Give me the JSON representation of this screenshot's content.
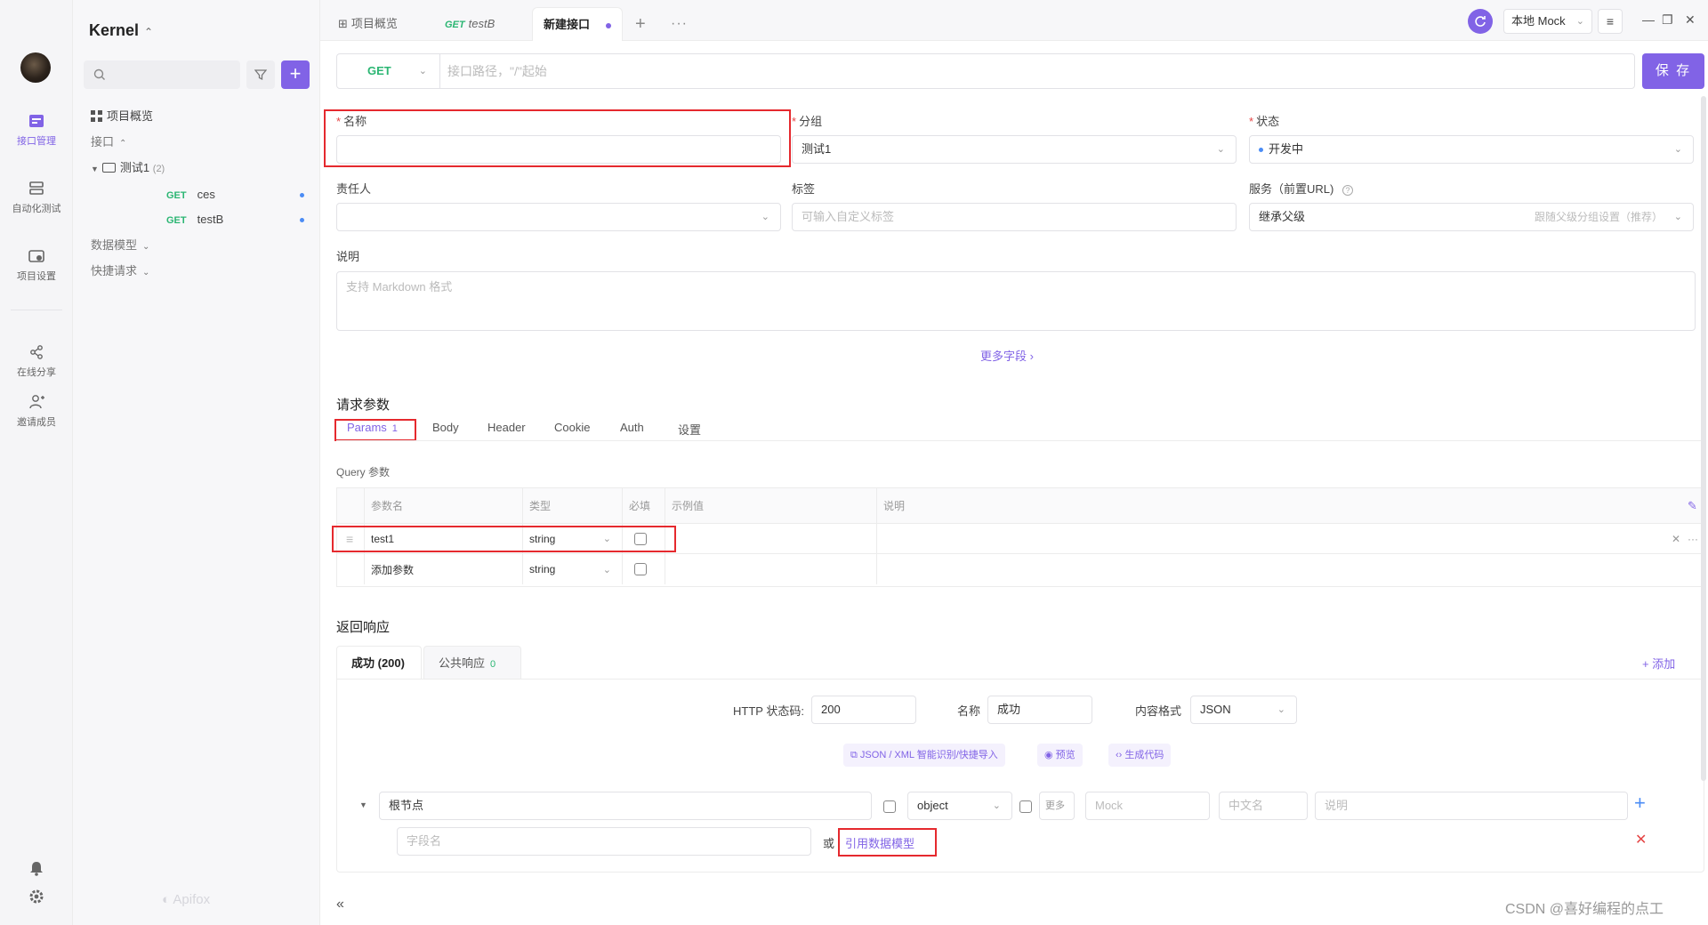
{
  "rail": {
    "items": [
      {
        "label": "接口管理",
        "icon": "api-management-icon",
        "active": true
      },
      {
        "label": "自动化测试",
        "icon": "automation-test-icon",
        "active": false
      },
      {
        "label": "项目设置",
        "icon": "project-settings-icon",
        "active": false
      },
      {
        "label": "在线分享",
        "icon": "share-icon",
        "active": false
      },
      {
        "label": "邀请成员",
        "icon": "invite-member-icon",
        "active": false
      }
    ],
    "bottom_icons": [
      "bell-icon",
      "gear-icon"
    ]
  },
  "sidebar": {
    "project_name": "Kernel",
    "search_placeholder": "",
    "tree": {
      "overview": "项目概览",
      "api_section": "接口",
      "folder": {
        "name": "测试1",
        "count": "(2)"
      },
      "endpoints": [
        {
          "method": "GET",
          "name": "ces"
        },
        {
          "method": "GET",
          "name": "testB"
        }
      ],
      "data_models": "数据模型",
      "quick_requests": "快捷请求"
    },
    "logo_text": "Apifox"
  },
  "tabs": [
    {
      "label": "项目概览",
      "icon": "grid-icon"
    },
    {
      "method": "GET",
      "label": "testB"
    },
    {
      "label": "新建接口",
      "active": true,
      "unsaved": true
    }
  ],
  "topbar": {
    "environment": "本地 Mock"
  },
  "urlbar": {
    "method": "GET",
    "path_placeholder": "接口路径，\"/\"起始",
    "save_label": "保 存"
  },
  "form": {
    "name_label": "名称",
    "name_value": "",
    "group_label": "分组",
    "group_value": "测试1",
    "status_label": "状态",
    "status_value": "开发中",
    "owner_label": "责任人",
    "owner_value": "",
    "tags_label": "标签",
    "tags_placeholder": "可输入自定义标签",
    "service_label": "服务（前置URL)",
    "service_value": "继承父级",
    "service_hint": "跟随父级分组设置（推荐）",
    "desc_label": "说明",
    "desc_placeholder": "支持 Markdown 格式",
    "more_fields": "更多字段"
  },
  "request": {
    "title": "请求参数",
    "tabs": [
      {
        "label": "Params",
        "count": "1",
        "active": true
      },
      {
        "label": "Body"
      },
      {
        "label": "Header"
      },
      {
        "label": "Cookie"
      },
      {
        "label": "Auth"
      },
      {
        "label": "设置"
      }
    ],
    "query_title": "Query 参数",
    "columns": [
      "参数名",
      "类型",
      "必填",
      "示例值",
      "说明"
    ],
    "rows": [
      {
        "name": "test1",
        "type": "string",
        "required": false,
        "example": "",
        "desc": ""
      }
    ],
    "add_row": {
      "name_placeholder": "添加参数",
      "type": "string"
    }
  },
  "response": {
    "title": "返回响应",
    "tabs": [
      {
        "label": "成功 (200)",
        "active": true
      },
      {
        "label": "公共响应",
        "count": "0"
      }
    ],
    "add_label": "+ 添加",
    "http_status_label": "HTTP 状态码:",
    "http_status_value": "200",
    "name_label": "名称",
    "name_value": "成功",
    "content_type_label": "内容格式",
    "content_type_value": "JSON",
    "tools": [
      {
        "label": "JSON / XML 智能识别/快捷导入",
        "icon": "import-icon"
      },
      {
        "label": "预览",
        "icon": "eye-icon"
      },
      {
        "label": "生成代码",
        "icon": "code-icon"
      }
    ],
    "schema": {
      "root_label": "根节点",
      "root_type": "object",
      "more_label": "更多",
      "mock_placeholder": "Mock",
      "cn_name_placeholder": "中文名",
      "desc_placeholder": "说明",
      "field_placeholder": "字段名",
      "or_label": "或",
      "ref_model_label": "引用数据模型"
    }
  },
  "watermark": "CSDN @喜好编程的点工",
  "colors": {
    "accent": "#8163e6",
    "get_method": "#2bb673",
    "highlight_box": "#e5292e",
    "required_star": "#e54545"
  }
}
